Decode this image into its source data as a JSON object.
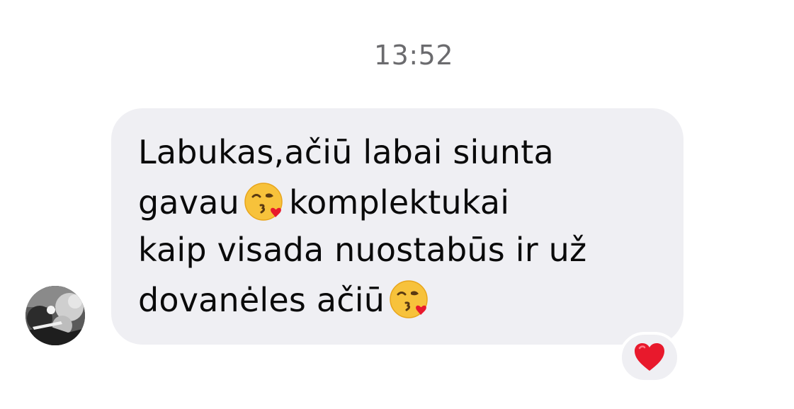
{
  "conversation": {
    "timestamp": "13:52",
    "message": {
      "line1": "Labukas,ačiū labai siunta",
      "line2_before_emoji": "gavau",
      "line2_after_emoji": "komplektukai",
      "line3": "kaip visada nuostabūs ir už",
      "line4_before_emoji": "dovanėles ačiū",
      "emoji_icon": "face-blowing-kiss-icon"
    },
    "reaction": {
      "icon": "red-heart-icon",
      "color": "#e8192c"
    },
    "colors": {
      "bubble": "#efeff3",
      "timestamp": "#6b6b6e",
      "text": "#0a0a0a"
    }
  }
}
